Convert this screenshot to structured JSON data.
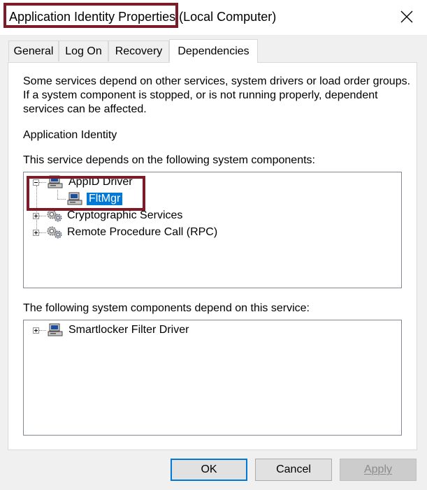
{
  "window": {
    "title_main": "Application Identity Properties",
    "title_suffix": " (Local Computer)"
  },
  "tabs": [
    {
      "label": "General",
      "active": false
    },
    {
      "label": "Log On",
      "active": false
    },
    {
      "label": "Recovery",
      "active": false
    },
    {
      "label": "Dependencies",
      "active": true
    }
  ],
  "dependencies": {
    "intro_lines": [
      "Some services depend on other services, system drivers or load order groups.",
      "If a system component is stopped, or is not running properly, dependent",
      "services can be affected."
    ],
    "service_name": "Application Identity",
    "depends_on_label": "This service depends on the following system components:",
    "depends_on_tree": [
      {
        "label": "AppID Driver",
        "icon": "computer-icon",
        "expander": "minus"
      },
      {
        "label": "FltMgr",
        "icon": "computer-icon",
        "selected": true,
        "child": true
      },
      {
        "label": "Cryptographic Services",
        "icon": "gears-icon",
        "expander": "plus"
      },
      {
        "label": "Remote Procedure Call (RPC)",
        "icon": "gears-icon",
        "expander": "plus"
      }
    ],
    "dependents_label": "The following system components depend on this service:",
    "dependents_tree": [
      {
        "label": "Smartlocker Filter Driver",
        "icon": "computer-icon",
        "expander": "plus"
      }
    ]
  },
  "buttons": {
    "ok": "OK",
    "cancel": "Cancel",
    "apply": "Apply"
  },
  "colors": {
    "highlight_box": "#7b1c28",
    "selection": "#0078d7",
    "default_button_border": "#0078d7"
  }
}
